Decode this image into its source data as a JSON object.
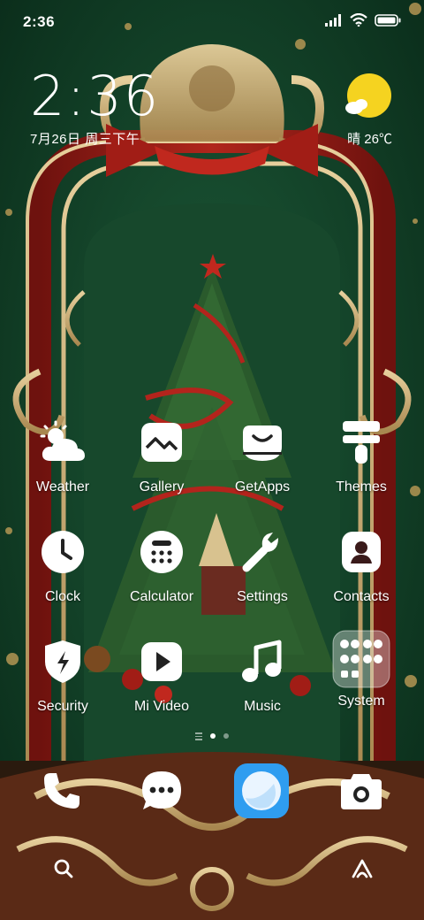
{
  "status_bar": {
    "time": "2:36",
    "icons": [
      "signal-icon",
      "wifi-icon",
      "battery-icon"
    ]
  },
  "clock_widget": {
    "time": "2:36",
    "date": "7月26日 周三下午",
    "weather": "晴 26℃",
    "weather_icon": "sun-cloud-icon"
  },
  "apps": [
    {
      "label": "Weather",
      "icon": "weather-icon"
    },
    {
      "label": "Gallery",
      "icon": "gallery-icon"
    },
    {
      "label": "GetApps",
      "icon": "getapps-icon"
    },
    {
      "label": "Themes",
      "icon": "themes-icon"
    },
    {
      "label": "Clock",
      "icon": "clock-icon"
    },
    {
      "label": "Calculator",
      "icon": "calculator-icon"
    },
    {
      "label": "Settings",
      "icon": "settings-icon"
    },
    {
      "label": "Contacts",
      "icon": "contacts-icon"
    },
    {
      "label": "Security",
      "icon": "security-icon"
    },
    {
      "label": "Mi Video",
      "icon": "mi-video-icon"
    },
    {
      "label": "Music",
      "icon": "music-icon"
    },
    {
      "label": "System",
      "icon": "system-folder-icon"
    }
  ],
  "page_indicator": {
    "pages": 2,
    "current": 1
  },
  "dock": [
    "phone-icon",
    "messages-icon",
    "browser-icon",
    "camera-icon"
  ],
  "bottom_bar": [
    "search-icon",
    "assistant-icon"
  ],
  "colors": {
    "background": "#0f3a24",
    "frame_red": "#8e1a14",
    "frame_gold": "#cdb07c",
    "sun": "#f5d320",
    "browser_icon": "#2f9df0"
  }
}
